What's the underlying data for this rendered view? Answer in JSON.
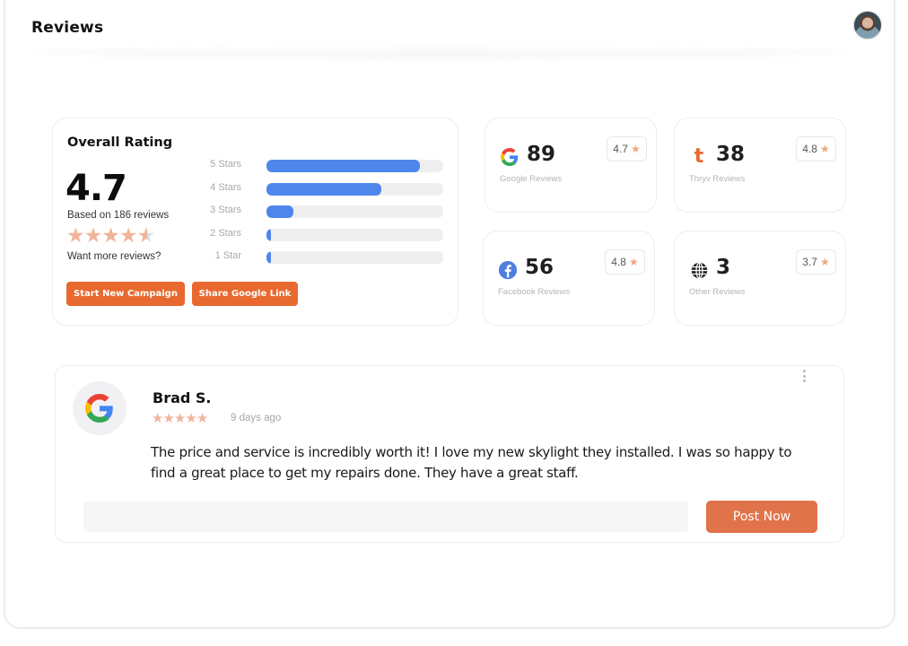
{
  "header": {
    "title": "Reviews",
    "avatar_icon": "user-avatar"
  },
  "overall": {
    "title": "Overall Rating",
    "score": "4.7",
    "based_on": "Based on 186 reviews",
    "star_rating": 4.7,
    "stars": "★★★★",
    "partial_star": "★",
    "want_more": "Want more reviews?",
    "distribution": [
      {
        "label": "5 Stars",
        "fraction": 0.87
      },
      {
        "label": "4 Stars",
        "fraction": 0.65
      },
      {
        "label": "3 Stars",
        "fraction": 0.15
      },
      {
        "label": "2 Stars",
        "fraction": 0.025
      },
      {
        "label": "1 Star",
        "fraction": 0.025
      }
    ],
    "buttons": {
      "start_campaign": "Start New Campaign",
      "share_google": "Share Google Link"
    },
    "bar_color": "#4f86ec",
    "accent_color": "#e8692f"
  },
  "sources": [
    {
      "name": "google",
      "icon": "google-icon",
      "count": "89",
      "label": "Google Reviews",
      "rating": "4.7"
    },
    {
      "name": "thryv",
      "icon": "thryv-icon",
      "count": "38",
      "label": "Thryv Reviews",
      "rating": "4.8"
    },
    {
      "name": "facebook",
      "icon": "facebook-icon",
      "count": "56",
      "label": "Facebook Reviews",
      "rating": "4.8"
    },
    {
      "name": "other",
      "icon": "globe-icon",
      "count": "3",
      "label": "Other Reviews",
      "rating": "3.7"
    }
  ],
  "star_glyph": "★",
  "review": {
    "source_icon": "google-icon",
    "author": "Brad S.",
    "stars": "★★★★★",
    "rating": 5,
    "time_ago": "9 days ago",
    "text": "The price and service is incredibly worth it! I love my new skylight they installed. I was so happy to find a great place to get my repairs done. They have a great staff.",
    "reply_value": "",
    "reply_placeholder": "",
    "post_button": "Post Now",
    "more_icon": "more-vertical-icon"
  }
}
